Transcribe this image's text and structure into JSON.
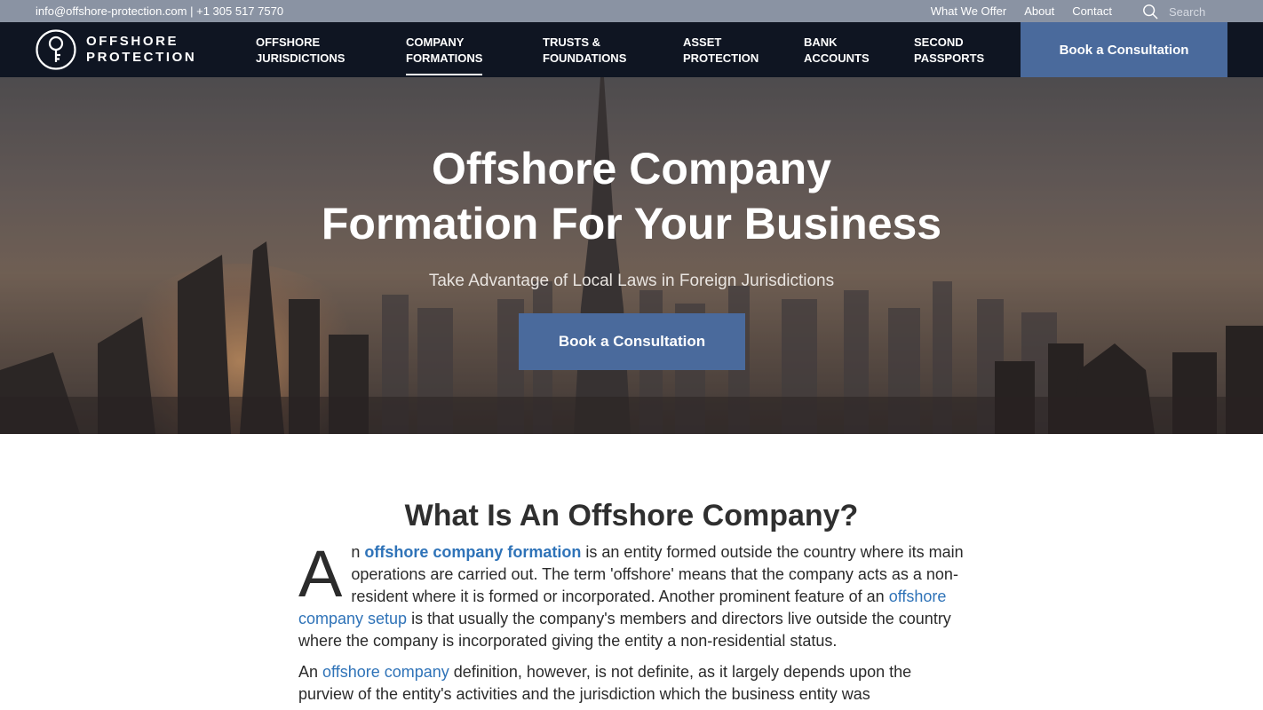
{
  "topbar": {
    "email": "info@offshore-protection.com",
    "separator": " | ",
    "phone": "+1 305 517 7570",
    "links": [
      "What We Offer",
      "About",
      "Contact"
    ],
    "search_placeholder": "Search"
  },
  "brand": {
    "line1": "OFFSHORE",
    "line2": "PROTECTION"
  },
  "nav": {
    "items": [
      {
        "l1": "OFFSHORE",
        "l2": "JURISDICTIONS"
      },
      {
        "l1": "COMPANY",
        "l2": "FORMATIONS"
      },
      {
        "l1": "TRUSTS &",
        "l2": "FOUNDATIONS"
      },
      {
        "l1": "ASSET",
        "l2": "PROTECTION"
      },
      {
        "l1": "BANK",
        "l2": "ACCOUNTS"
      },
      {
        "l1": "SECOND",
        "l2": "PASSPORTS"
      }
    ],
    "active_index": 1,
    "cta": "Book a Consultation"
  },
  "hero": {
    "title_line1": "Offshore Company",
    "title_line2": "Formation For Your Business",
    "subtitle": "Take Advantage of Local Laws in Foreign Jurisdictions",
    "cta": "Book a Consultation"
  },
  "article": {
    "heading": "What Is An Offshore Company?",
    "p1": {
      "dropcap": "A",
      "lead": "n ",
      "link1": "offshore company formation",
      "text1": " is an entity formed outside the country where its main operations are carried out. The term 'offshore' means that the company acts as a non-resident where it is formed or incorporated. Another prominent feature of an ",
      "link2": "offshore company setup",
      "text2": " is that usually the company's members and directors live outside the country where the company is incorporated giving the entity a non-residential status."
    },
    "p2": {
      "lead": "An ",
      "link": "offshore company",
      "text": " definition, however, is not definite, as it largely depends upon the purview of the entity's activities and the jurisdiction which the business entity was"
    }
  },
  "colors": {
    "topbar_bg": "#8a93a3",
    "nav_bg": "#0f1522",
    "accent_button": "#4a6a9c",
    "link": "#2f73b8"
  }
}
